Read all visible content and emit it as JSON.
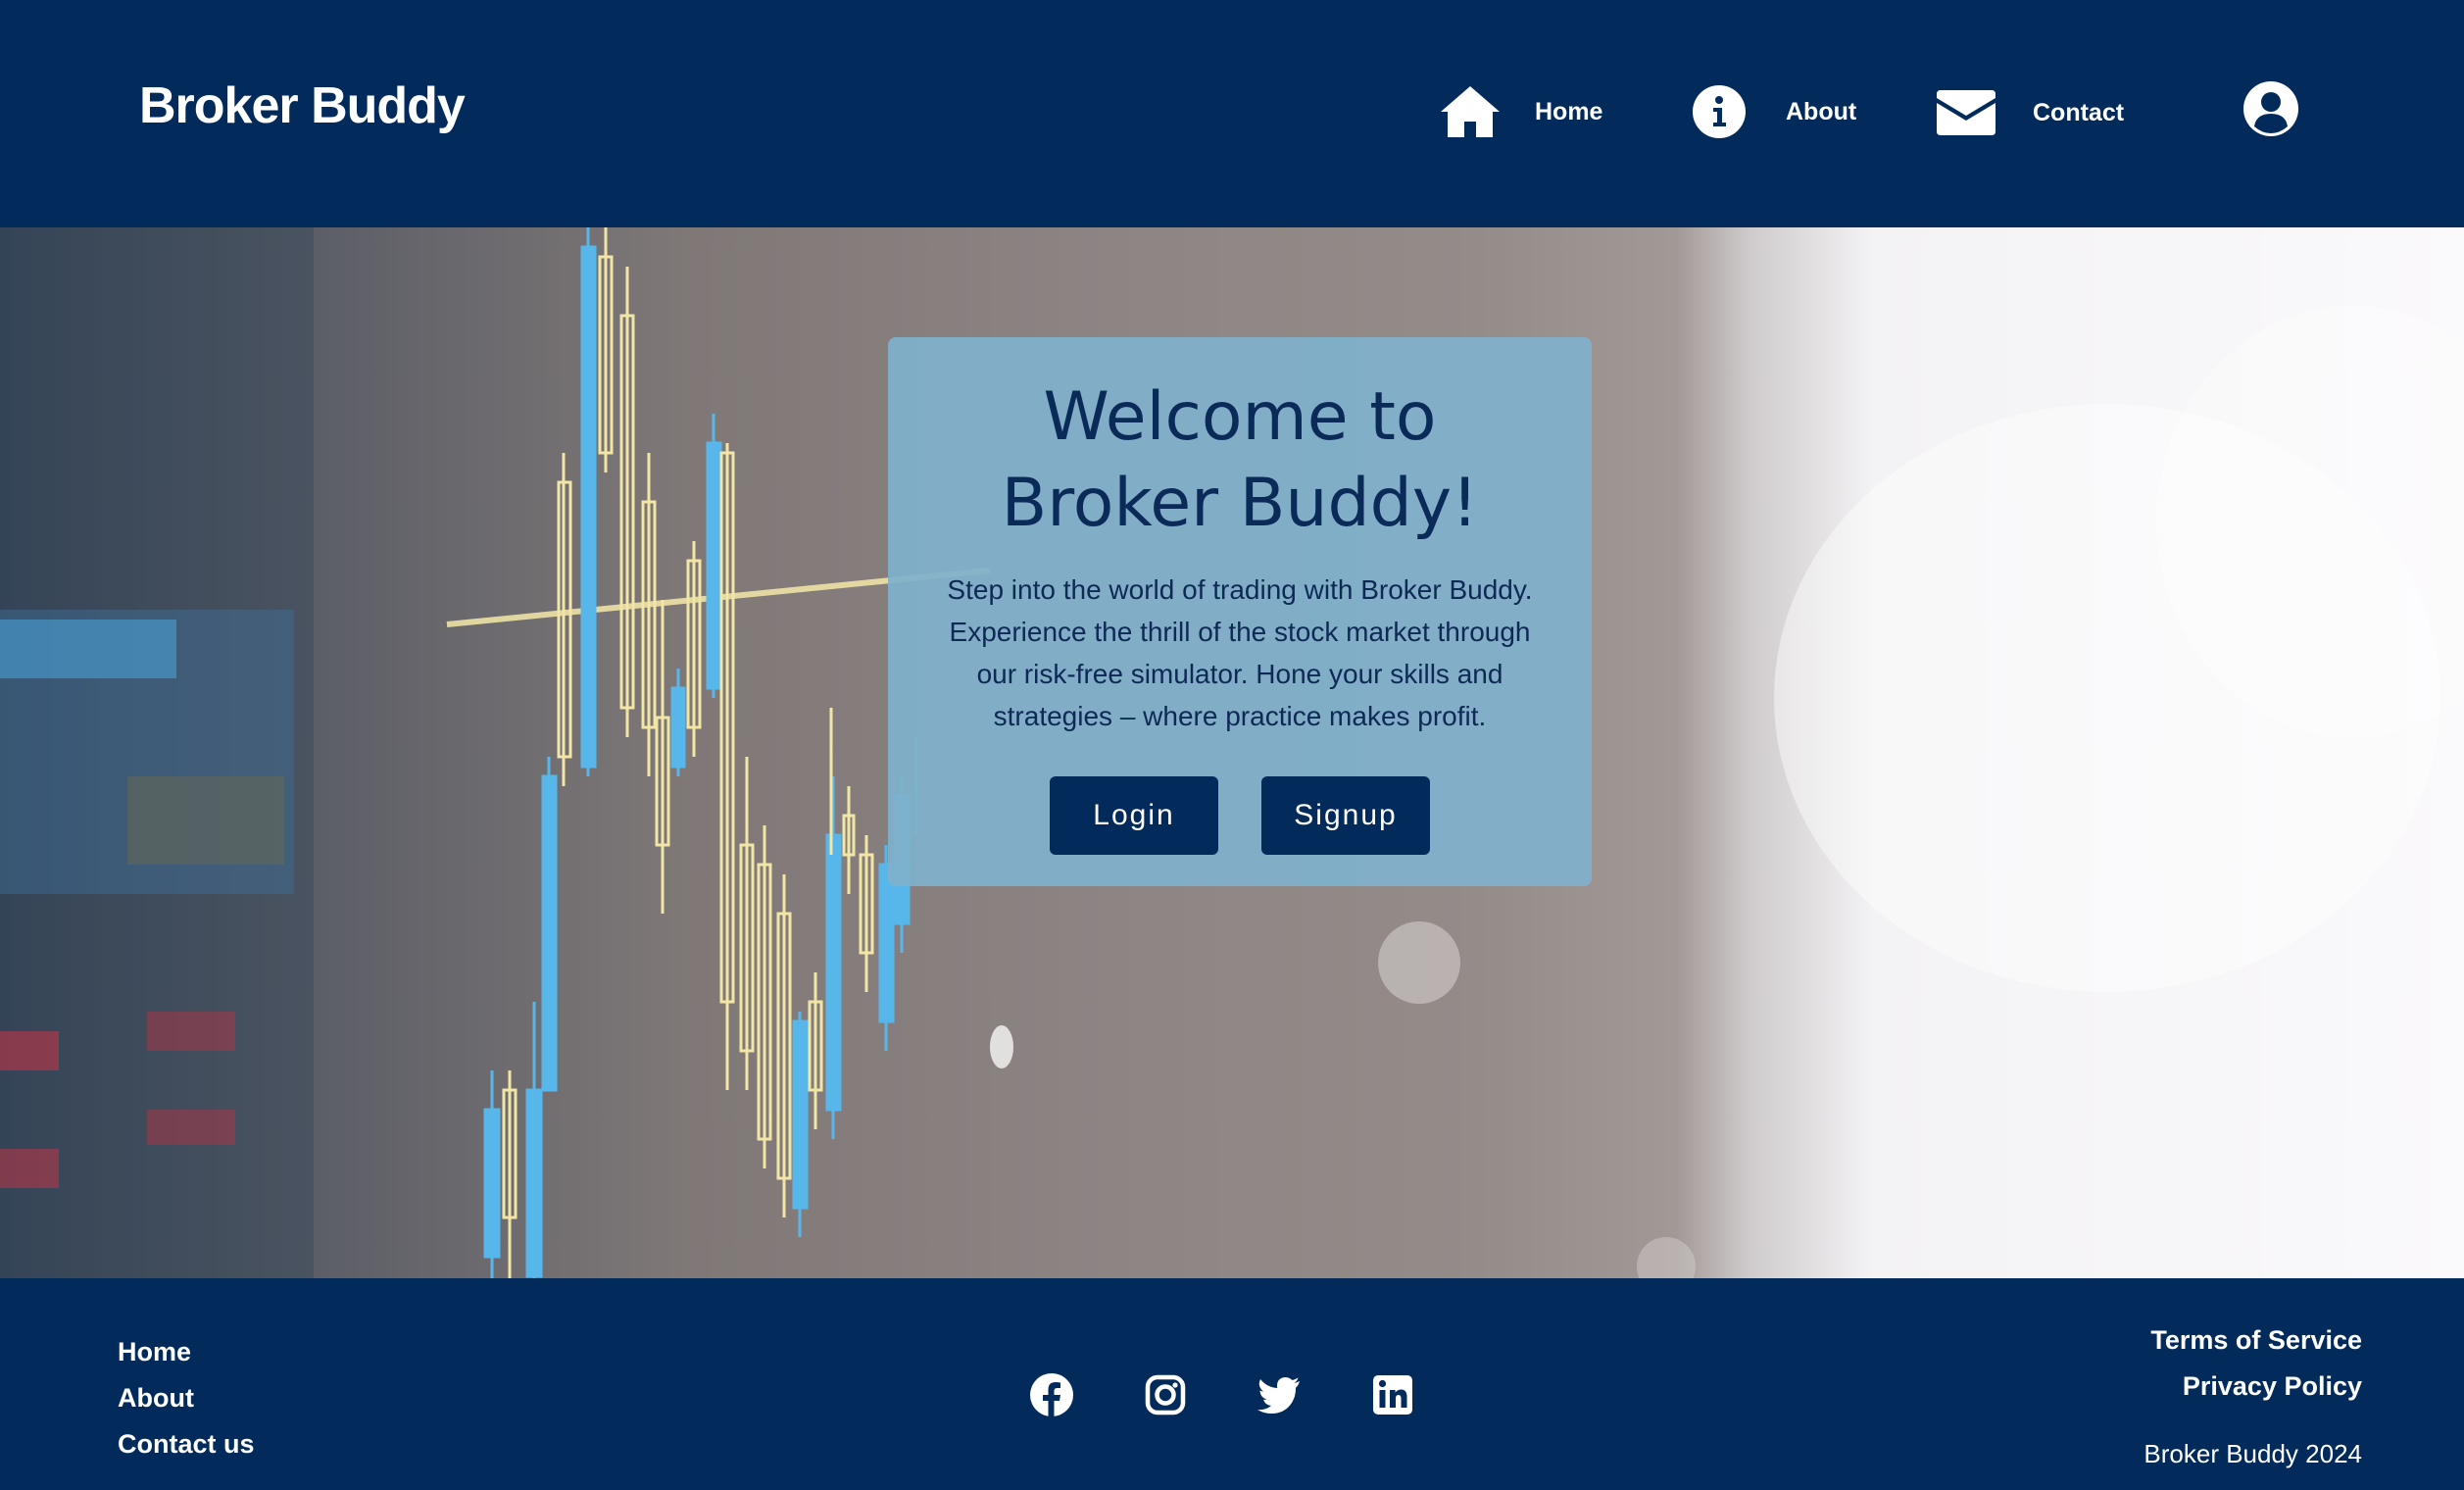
{
  "header": {
    "brand": "Broker Buddy",
    "nav": [
      {
        "label": "Home",
        "icon": "home-icon"
      },
      {
        "label": "About",
        "icon": "info-icon"
      },
      {
        "label": "Contact",
        "icon": "envelope-icon"
      }
    ],
    "user_icon": "user-circle-icon"
  },
  "hero": {
    "title_line1": "Welcome to",
    "title_line2": "Broker Buddy!",
    "text": "Step into the world of trading with Broker Buddy. Experience the thrill of the stock market through our risk-free simulator. Hone your skills and strategies – where practice makes profit.",
    "login_label": "Login",
    "signup_label": "Signup"
  },
  "footer": {
    "links": [
      "Home",
      "About",
      "Contact us"
    ],
    "socials": [
      "facebook-icon",
      "instagram-icon",
      "twitter-icon",
      "linkedin-icon"
    ],
    "legal": [
      "Terms of Service",
      "Privacy Policy"
    ],
    "copyright": "Broker Buddy 2024"
  },
  "colors": {
    "primary": "#022b5c",
    "card": "#80b1cc",
    "white": "#ffffff"
  }
}
